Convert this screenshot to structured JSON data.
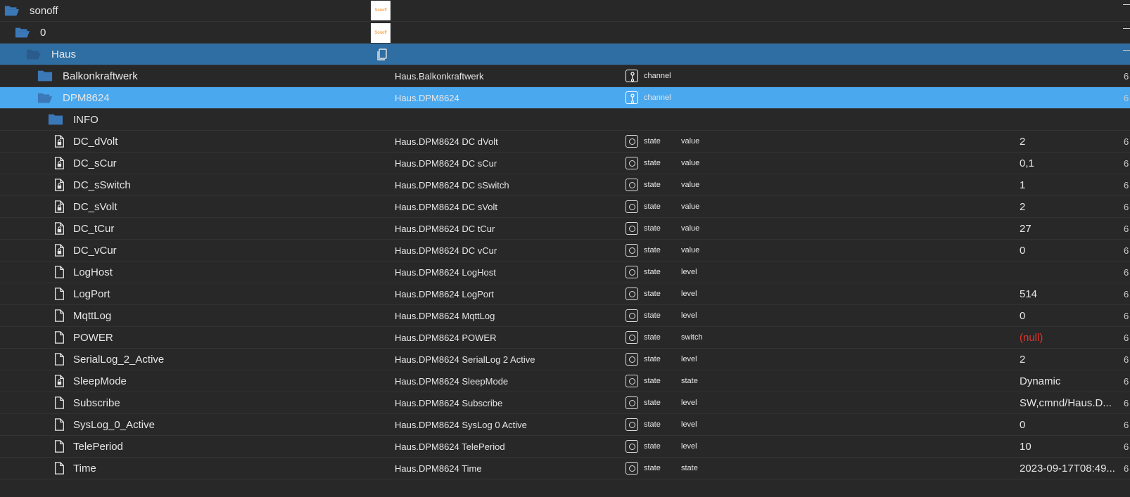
{
  "tree": {
    "rows": [
      {
        "kind": "folder",
        "open": true,
        "level": 0,
        "name": "sonoff",
        "logo": "Sonoff",
        "edge": ""
      },
      {
        "kind": "folder",
        "open": true,
        "level": 1,
        "name": "0",
        "logo": "Sonoff",
        "edge": ""
      },
      {
        "kind": "folder",
        "open": true,
        "level": 2,
        "name": "Haus",
        "copy": true,
        "selected": "dark",
        "edge": ""
      },
      {
        "kind": "folder",
        "open": false,
        "level": 3,
        "name": "Balkonkraftwerk",
        "id": "Haus.Balkonkraftwerk",
        "type": "channel",
        "edge": "6"
      },
      {
        "kind": "folder",
        "open": true,
        "level": 3,
        "name": "DPM8624",
        "id": "Haus.DPM8624",
        "type": "channel",
        "selected": "light",
        "edge": "6"
      },
      {
        "kind": "folder",
        "open": false,
        "level": 4,
        "name": "INFO",
        "edge": ""
      },
      {
        "kind": "file",
        "locked": true,
        "level": 4,
        "name": "DC_dVolt",
        "id": "Haus.DPM8624 DC dVolt",
        "type": "state",
        "role": "value",
        "value": "2",
        "edge": "6"
      },
      {
        "kind": "file",
        "locked": true,
        "level": 4,
        "name": "DC_sCur",
        "id": "Haus.DPM8624 DC sCur",
        "type": "state",
        "role": "value",
        "value": "0,1",
        "edge": "6"
      },
      {
        "kind": "file",
        "locked": true,
        "level": 4,
        "name": "DC_sSwitch",
        "id": "Haus.DPM8624 DC sSwitch",
        "type": "state",
        "role": "value",
        "value": "1",
        "edge": "6"
      },
      {
        "kind": "file",
        "locked": true,
        "level": 4,
        "name": "DC_sVolt",
        "id": "Haus.DPM8624 DC sVolt",
        "type": "state",
        "role": "value",
        "value": "2",
        "edge": "6"
      },
      {
        "kind": "file",
        "locked": true,
        "level": 4,
        "name": "DC_tCur",
        "id": "Haus.DPM8624 DC tCur",
        "type": "state",
        "role": "value",
        "value": "27",
        "edge": "6"
      },
      {
        "kind": "file",
        "locked": true,
        "level": 4,
        "name": "DC_vCur",
        "id": "Haus.DPM8624 DC vCur",
        "type": "state",
        "role": "value",
        "value": "0",
        "edge": "6"
      },
      {
        "kind": "file",
        "locked": false,
        "level": 4,
        "name": "LogHost",
        "id": "Haus.DPM8624 LogHost",
        "type": "state",
        "role": "level",
        "value": "",
        "edge": "6"
      },
      {
        "kind": "file",
        "locked": false,
        "level": 4,
        "name": "LogPort",
        "id": "Haus.DPM8624 LogPort",
        "type": "state",
        "role": "level",
        "value": "514",
        "edge": "6"
      },
      {
        "kind": "file",
        "locked": false,
        "level": 4,
        "name": "MqttLog",
        "id": "Haus.DPM8624 MqttLog",
        "type": "state",
        "role": "level",
        "value": "0",
        "edge": "6"
      },
      {
        "kind": "file",
        "locked": false,
        "level": 4,
        "name": "POWER",
        "id": "Haus.DPM8624 POWER",
        "type": "state",
        "role": "switch",
        "value": "(null)",
        "null": true,
        "edge": "6"
      },
      {
        "kind": "file",
        "locked": false,
        "level": 4,
        "name": "SerialLog_2_Active",
        "id": "Haus.DPM8624 SerialLog 2 Active",
        "type": "state",
        "role": "level",
        "value": "2",
        "edge": "6"
      },
      {
        "kind": "file",
        "locked": true,
        "level": 4,
        "name": "SleepMode",
        "id": "Haus.DPM8624 SleepMode",
        "type": "state",
        "role": "state",
        "value": "Dynamic",
        "edge": "6"
      },
      {
        "kind": "file",
        "locked": false,
        "level": 4,
        "name": "Subscribe",
        "id": "Haus.DPM8624 Subscribe",
        "type": "state",
        "role": "level",
        "value": "SW,cmnd/Haus.D...",
        "edge": "6"
      },
      {
        "kind": "file",
        "locked": false,
        "level": 4,
        "name": "SysLog_0_Active",
        "id": "Haus.DPM8624 SysLog 0 Active",
        "type": "state",
        "role": "level",
        "value": "0",
        "edge": "6"
      },
      {
        "kind": "file",
        "locked": false,
        "level": 4,
        "name": "TelePeriod",
        "id": "Haus.DPM8624 TelePeriod",
        "type": "state",
        "role": "level",
        "value": "10",
        "edge": "6"
      },
      {
        "kind": "file",
        "locked": false,
        "level": 4,
        "name": "Time",
        "id": "Haus.DPM8624 Time",
        "type": "state",
        "role": "state",
        "value": "2023-09-17T08:49...",
        "edge": "6"
      }
    ]
  },
  "colors": {
    "folder": "#3b78b8",
    "folderOpenOnBlue": "#2b5b8c",
    "text": "#e6e6e6",
    "selectedDark": "#2f6ea2",
    "selectedLight": "#4aa8ef",
    "nullValue": "#e0332b"
  },
  "icons": {
    "folder": "folder-icon",
    "folderOpen": "folder-open-icon",
    "file": "file-icon",
    "fileLocked": "file-lock-icon",
    "channel": "channel-icon",
    "state": "state-icon",
    "copy": "copy-icon"
  }
}
